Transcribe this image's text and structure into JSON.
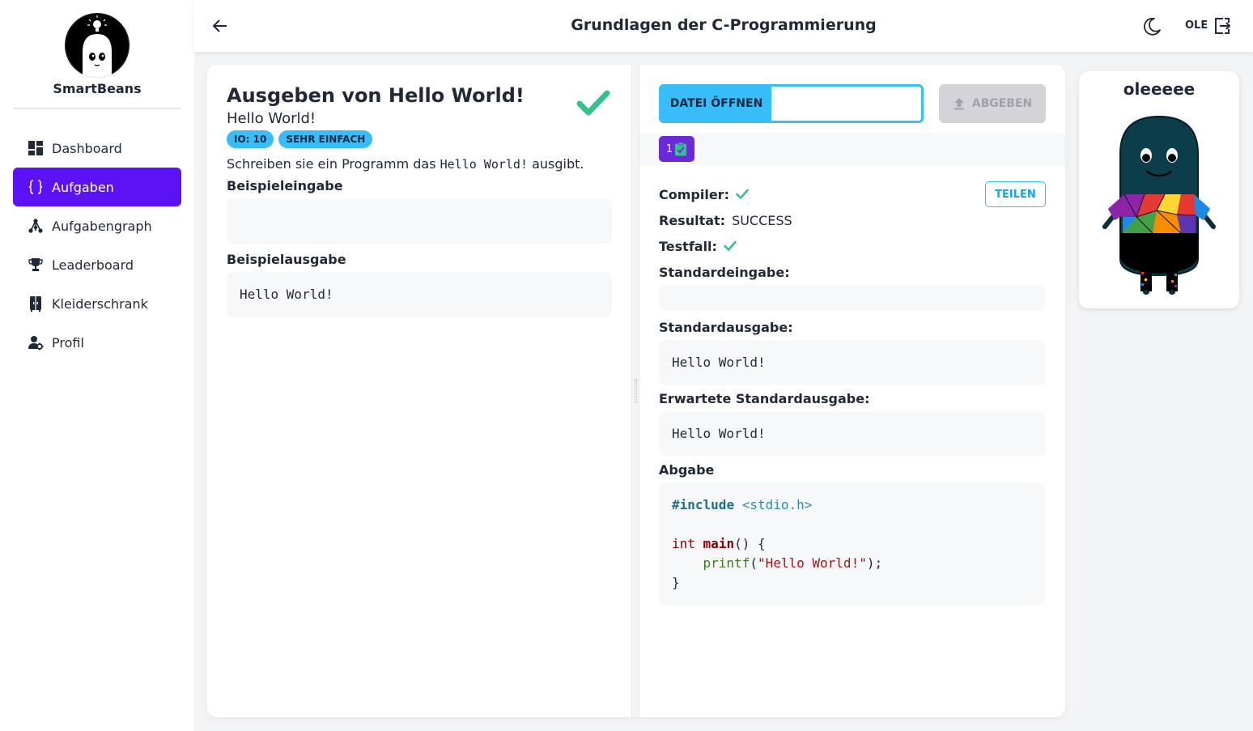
{
  "app": {
    "name": "SmartBeans"
  },
  "sidebar": {
    "items": [
      {
        "label": "Dashboard",
        "icon": "dashboard-icon",
        "active": false
      },
      {
        "label": "Aufgaben",
        "icon": "braces-icon",
        "active": true
      },
      {
        "label": "Aufgabengraph",
        "icon": "graph-icon",
        "active": false
      },
      {
        "label": "Leaderboard",
        "icon": "trophy-icon",
        "active": false
      },
      {
        "label": "Kleiderschrank",
        "icon": "wardrobe-icon",
        "active": false
      },
      {
        "label": "Profil",
        "icon": "user-settings-icon",
        "active": false
      }
    ]
  },
  "header": {
    "title": "Grundlagen der C-Programmierung",
    "user": "OLE"
  },
  "task": {
    "title": "Ausgeben von Hello World!",
    "subtitle": "Hello World!",
    "badges": [
      "IO: 10",
      "SEHR EINFACH"
    ],
    "description_before": "Schreiben sie ein Programm das ",
    "description_code": "Hello World!",
    "description_after": " ausgibt.",
    "example_input_label": "Beispieleingabe",
    "example_input": "",
    "example_output_label": "Beispielausgabe",
    "example_output": "Hello World!"
  },
  "submission": {
    "file_open_label": "DATEI ÖFFNEN",
    "file_name": "",
    "submit_label": "ABGEBEN",
    "attempt_number": "1",
    "share_label": "TEILEN",
    "compiler_label": "Compiler:",
    "result_label": "Resultat:",
    "result_value": "SUCCESS",
    "testcase_label": "Testfall:",
    "stdin_label": "Standardeingabe:",
    "stdin_value": "",
    "stdout_label": "Standardausgabe:",
    "stdout_value": "Hello World!",
    "expected_label": "Erwartete Standardausgabe:",
    "expected_value": "Hello World!",
    "code_label": "Abgabe"
  },
  "avatar": {
    "name": "oleeeee"
  },
  "colors": {
    "accent": "#5b12f5",
    "info": "#38bdf8",
    "success": "#34c28a",
    "attempt_tab": "#6d28d9"
  }
}
